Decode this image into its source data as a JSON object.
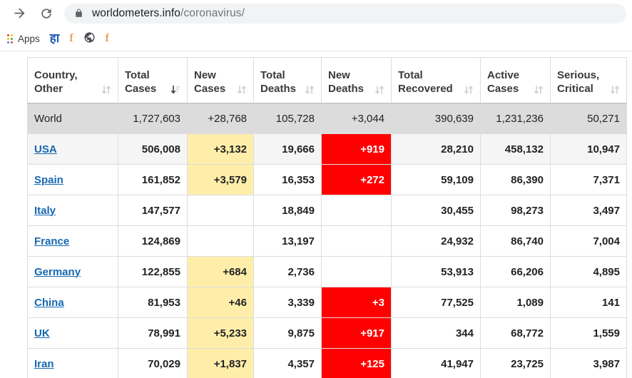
{
  "browser": {
    "back_icon": "back-arrow-icon",
    "forward_icon": "forward-arrow-icon",
    "reload_icon": "reload-icon",
    "lock_icon": "lock-icon",
    "url_host": "worldometers.info",
    "url_path": "/coronavirus/",
    "url_full": "worldometers.info/coronavirus/",
    "bookmarks": [
      {
        "label": "Apps",
        "icon": "apps-grid-icon"
      },
      {
        "label": "हा",
        "icon": "hindi-bookmark-icon"
      },
      {
        "label": "f",
        "icon": "f-bookmark-icon"
      },
      {
        "label": "",
        "icon": "globe-icon"
      },
      {
        "label": "f",
        "icon": "f-bookmark-icon"
      }
    ]
  },
  "table": {
    "columns": [
      {
        "label_line1": "Country,",
        "label_line2": "Other",
        "sort": "inactive"
      },
      {
        "label_line1": "Total",
        "label_line2": "Cases",
        "sort": "desc-active"
      },
      {
        "label_line1": "New",
        "label_line2": "Cases",
        "sort": "inactive"
      },
      {
        "label_line1": "Total",
        "label_line2": "Deaths",
        "sort": "inactive"
      },
      {
        "label_line1": "New",
        "label_line2": "Deaths",
        "sort": "inactive"
      },
      {
        "label_line1": "Total",
        "label_line2": "Recovered",
        "sort": "inactive"
      },
      {
        "label_line1": "Active",
        "label_line2": "Cases",
        "sort": "inactive"
      },
      {
        "label_line1": "Serious,",
        "label_line2": "Critical",
        "sort": "inactive"
      }
    ],
    "rows": [
      {
        "style": "world",
        "country": "World",
        "is_link": false,
        "total_cases": "1,727,603",
        "new_cases": "+28,768",
        "new_cases_hl": "none",
        "total_deaths": "105,728",
        "new_deaths": "+3,044",
        "new_deaths_hl": "none",
        "total_recovered": "390,639",
        "active_cases": "1,231,236",
        "serious_critical": "50,271"
      },
      {
        "style": "shaded",
        "country": "USA",
        "is_link": true,
        "total_cases": "506,008",
        "new_cases": "+3,132",
        "new_cases_hl": "yellow",
        "total_deaths": "19,666",
        "new_deaths": "+919",
        "new_deaths_hl": "red",
        "total_recovered": "28,210",
        "active_cases": "458,132",
        "serious_critical": "10,947"
      },
      {
        "style": "normal",
        "country": "Spain",
        "is_link": true,
        "total_cases": "161,852",
        "new_cases": "+3,579",
        "new_cases_hl": "yellow",
        "total_deaths": "16,353",
        "new_deaths": "+272",
        "new_deaths_hl": "red",
        "total_recovered": "59,109",
        "active_cases": "86,390",
        "serious_critical": "7,371"
      },
      {
        "style": "normal",
        "country": "Italy",
        "is_link": true,
        "total_cases": "147,577",
        "new_cases": "",
        "new_cases_hl": "none",
        "total_deaths": "18,849",
        "new_deaths": "",
        "new_deaths_hl": "none",
        "total_recovered": "30,455",
        "active_cases": "98,273",
        "serious_critical": "3,497"
      },
      {
        "style": "normal",
        "country": "France",
        "is_link": true,
        "total_cases": "124,869",
        "new_cases": "",
        "new_cases_hl": "none",
        "total_deaths": "13,197",
        "new_deaths": "",
        "new_deaths_hl": "none",
        "total_recovered": "24,932",
        "active_cases": "86,740",
        "serious_critical": "7,004"
      },
      {
        "style": "normal",
        "country": "Germany",
        "is_link": true,
        "total_cases": "122,855",
        "new_cases": "+684",
        "new_cases_hl": "yellow",
        "total_deaths": "2,736",
        "new_deaths": "",
        "new_deaths_hl": "none",
        "total_recovered": "53,913",
        "active_cases": "66,206",
        "serious_critical": "4,895"
      },
      {
        "style": "normal",
        "country": "China",
        "is_link": true,
        "total_cases": "81,953",
        "new_cases": "+46",
        "new_cases_hl": "yellow",
        "total_deaths": "3,339",
        "new_deaths": "+3",
        "new_deaths_hl": "red",
        "total_recovered": "77,525",
        "active_cases": "1,089",
        "serious_critical": "141"
      },
      {
        "style": "normal",
        "country": "UK",
        "is_link": true,
        "total_cases": "78,991",
        "new_cases": "+5,233",
        "new_cases_hl": "yellow",
        "total_deaths": "9,875",
        "new_deaths": "+917",
        "new_deaths_hl": "red",
        "total_recovered": "344",
        "active_cases": "68,772",
        "serious_critical": "1,559"
      },
      {
        "style": "normal",
        "country": "Iran",
        "is_link": true,
        "total_cases": "70,029",
        "new_cases": "+1,837",
        "new_cases_hl": "yellow",
        "total_deaths": "4,357",
        "new_deaths": "+125",
        "new_deaths_hl": "red",
        "total_recovered": "41,947",
        "active_cases": "23,725",
        "serious_critical": "3,987"
      }
    ]
  },
  "colors": {
    "highlight_yellow": "#ffeeaa",
    "highlight_red": "#ff0000",
    "world_row_bg": "#dcdcdc",
    "link_blue": "#1668b0"
  }
}
